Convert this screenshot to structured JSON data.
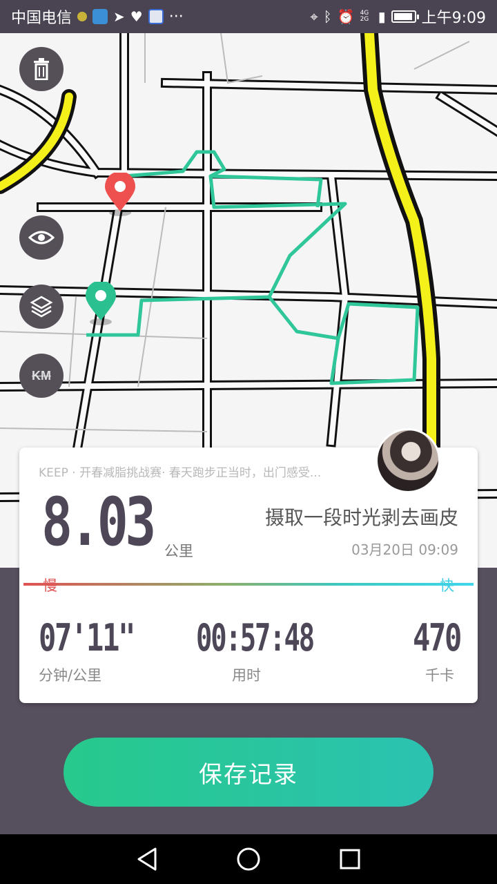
{
  "status_bar": {
    "carrier": "中国电信",
    "more": "···",
    "network": "4G 2G",
    "time": "上午9:09",
    "icons": [
      "location-icon",
      "bluetooth-icon",
      "alarm-icon",
      "battery-icon"
    ]
  },
  "map": {
    "buttons": [
      {
        "name": "trash-icon"
      },
      {
        "name": "eye-icon"
      },
      {
        "name": "layers-icon"
      },
      {
        "name": "km-icon",
        "label": "KM"
      }
    ],
    "route_color": "#2fc69a",
    "start_marker_color": "#2bc08f",
    "end_marker_color": "#ee4f4f",
    "highway_color": "#f2f11a"
  },
  "summary": {
    "event": "KEEP · 开春减脂挑战赛· 春天跑步正当时，出门感受...",
    "distance": "8.03",
    "distance_unit": "公里",
    "title": "摄取一段时光剥去画皮",
    "date": "03月20日 09:09",
    "pace_slow": "慢",
    "pace_fast": "快",
    "stats": [
      {
        "value": "07'11\"",
        "label": "分钟/公里"
      },
      {
        "value": "00:57:48",
        "label": "用时"
      },
      {
        "value": "470",
        "label": "千卡"
      }
    ]
  },
  "actions": {
    "save_label": "保存记录"
  },
  "nav": {
    "buttons": [
      "back-icon",
      "home-icon",
      "recents-icon"
    ]
  }
}
